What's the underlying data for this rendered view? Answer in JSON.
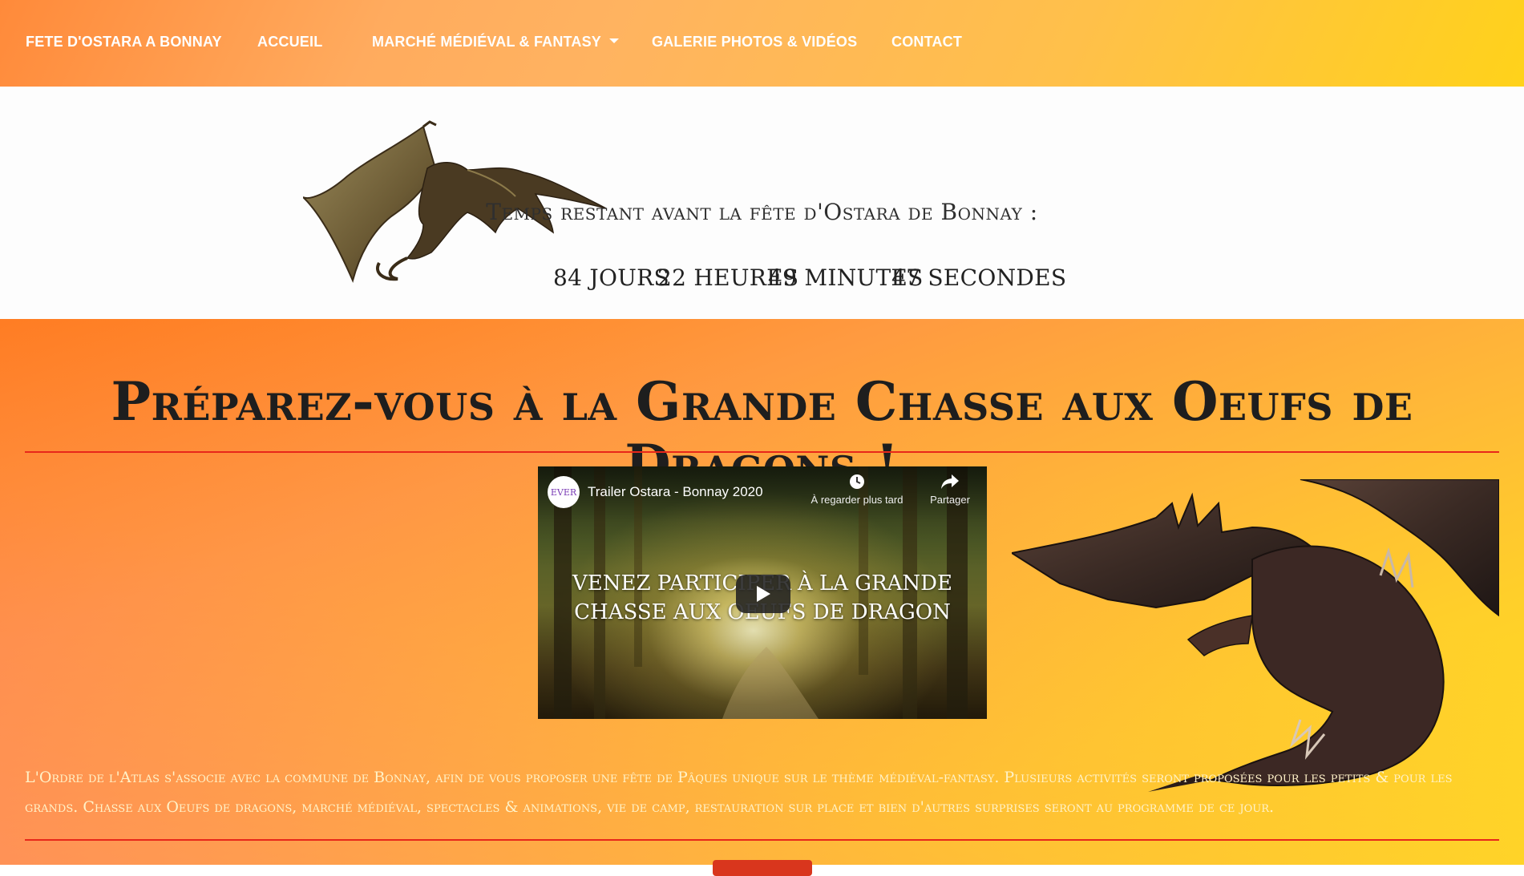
{
  "nav": {
    "brand": "FETE D'OSTARA A BONNAY",
    "items": [
      {
        "label": "ACCUEIL"
      },
      {
        "label": "MARCHÉ MÉDIÉVAL & FANTASY"
      },
      {
        "label": "GALERIE PHOTOS & VIDÉOS"
      },
      {
        "label": "CONTACT"
      }
    ]
  },
  "countdown": {
    "title": "Temps restant avant la fête d'Ostara de Bonnay :",
    "days": "84 JOURS",
    "hours": "22 HEURES",
    "minutes": "49 MINUTES",
    "seconds": "47 SECONDES"
  },
  "main": {
    "headline": "Préparez-vous à la Grande Chasse aux Oeufs de Dragons !",
    "description": "L'Ordre de l'Atlas s'associe avec la commune de Bonnay, afin de vous proposer une fête de Pâques unique sur le thème médiéval-fantasy. Plusieurs activités seront proposées pour les petits & pour les grands. Chasse aux Oeufs de dragons, marché médiéval, spectacles & animations, vie de camp, restauration sur place et bien d'autres surprises seront au programme de ce jour."
  },
  "video": {
    "channel_logo": "EVER",
    "title": "Trailer Ostara - Bonnay 2020",
    "watch_later": "À regarder plus tard",
    "share": "Partager",
    "caption_line1": "VENEZ PARTICIPER À LA GRANDE",
    "caption_line2": "CHASSE AUX OEUFS DE DRAGON"
  },
  "colors": {
    "accent_red": "#e8271a",
    "nav_gradient_start": "#ff8a3a",
    "nav_gradient_end": "#ffd21a"
  },
  "icons": [
    "caret-down-icon",
    "clock-icon",
    "share-icon",
    "play-icon",
    "dragon-image",
    "dragon-large-image"
  ]
}
